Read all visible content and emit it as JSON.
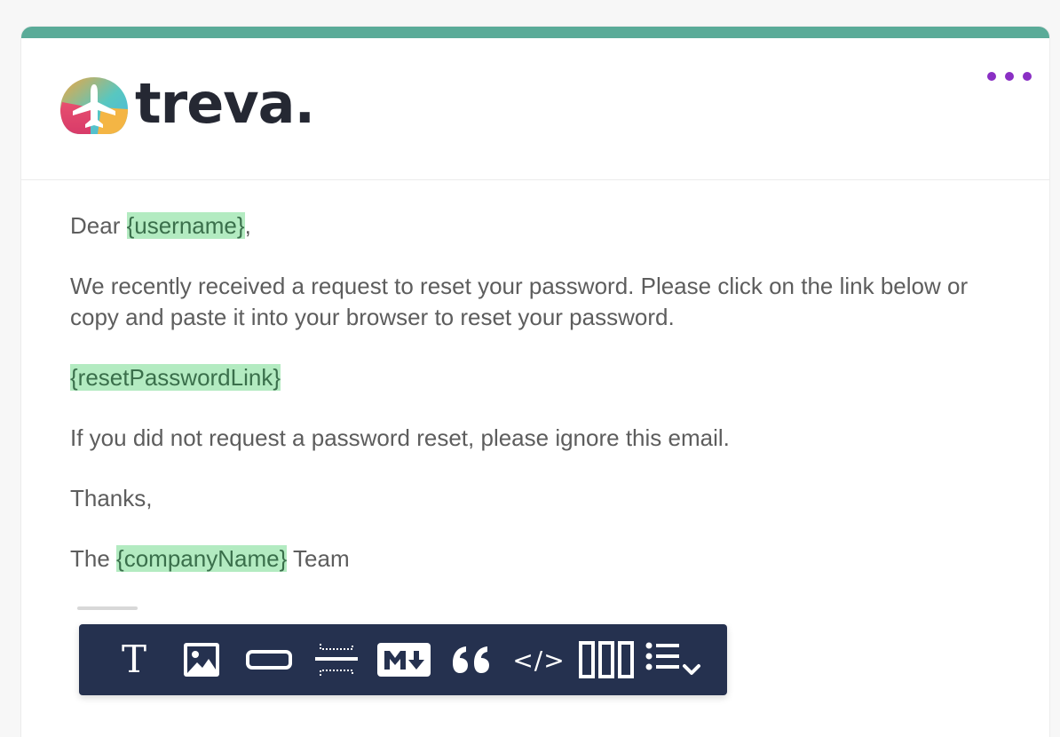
{
  "brand": {
    "name": "treva."
  },
  "email": {
    "greeting_prefix": "Dear ",
    "greeting_var": "{username}",
    "greeting_suffix": ",",
    "paragraph_1": "We recently received a request to reset your password. Please click on the link below or copy and paste it into your browser to reset your password.",
    "link_var": "{resetPasswordLink}",
    "paragraph_2": "If you did not request a password reset, please ignore this email.",
    "thanks": "Thanks,",
    "signoff_prefix": "The ",
    "signoff_var": "{companyName}",
    "signoff_suffix": " Team"
  },
  "colors": {
    "accent_bar": "#5aab98",
    "variable_highlight": "#b3ebc1",
    "toolbar_bg": "#25314f",
    "more_dots": "#8a2fc4"
  },
  "toolbar": {
    "text_glyph": "T",
    "code_glyph": "</>",
    "quote_glyph": "❝",
    "icons": [
      "text-icon",
      "image-icon",
      "button-icon",
      "divider-icon",
      "markdown-icon",
      "quote-icon",
      "code-icon",
      "columns-icon",
      "list-icon"
    ]
  }
}
